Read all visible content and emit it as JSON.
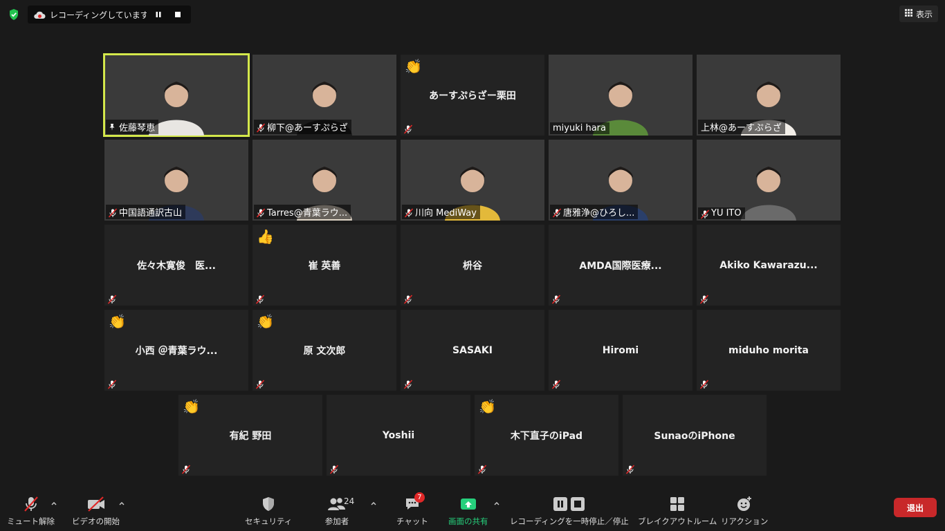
{
  "top": {
    "recording_text": "レコーディングしています...",
    "view_label": "表示"
  },
  "tiles": [
    {
      "name": "佐藤琴恵",
      "video": true,
      "bg": "bg-warm",
      "pinned": true,
      "active": true
    },
    {
      "name": "柳下@あーすぷらざ",
      "video": true,
      "bg": "bg-office",
      "muted": true
    },
    {
      "name": "あーすぷらざー栗田",
      "video": false,
      "emoji": "👏",
      "muted": true
    },
    {
      "name": "miyuki hara",
      "video": true,
      "bg": "bg-mountain",
      "muted": false
    },
    {
      "name": "上林@あーすぷらざ",
      "video": true,
      "bg": "bg-room",
      "muted": false
    },
    {
      "name": "中国語通訳古山",
      "video": true,
      "bg": "bg-white",
      "muted": true
    },
    {
      "name": "Tarres@青葉ラウ...",
      "video": true,
      "bg": "bg-red",
      "muted": true
    },
    {
      "name": "川向 MediWay",
      "video": true,
      "bg": "bg-light",
      "muted": true
    },
    {
      "name": "唐雅浄@ひろし...",
      "video": true,
      "bg": "bg-plain",
      "muted": true
    },
    {
      "name": "YU ITO",
      "video": true,
      "bg": "bg-curtain",
      "muted": true
    },
    {
      "name": "佐々木寛俊　医...",
      "video": false,
      "muted": true
    },
    {
      "name": "崔 英善",
      "video": false,
      "emoji": "👍",
      "muted": true
    },
    {
      "name": "枡谷",
      "video": false,
      "muted": true
    },
    {
      "name": "AMDA国際医療...",
      "video": false,
      "muted": true
    },
    {
      "name": "Akiko  Kawarazu...",
      "video": false,
      "muted": true
    },
    {
      "name": "小西 ＠青葉ラウ...",
      "video": false,
      "emoji": "👏",
      "muted": true
    },
    {
      "name": "原 文次郎",
      "video": false,
      "emoji": "👏",
      "muted": true
    },
    {
      "name": "SASAKI",
      "video": false,
      "muted": true
    },
    {
      "name": "Hiromi",
      "video": false,
      "muted": true
    },
    {
      "name": "miduho morita",
      "video": false,
      "muted": true
    },
    {
      "name": "有紀 野田",
      "video": false,
      "emoji": "👏",
      "muted": true
    },
    {
      "name": "Yoshii",
      "video": false,
      "muted": true
    },
    {
      "name": "木下直子のiPad",
      "video": false,
      "emoji": "👏",
      "muted": true
    },
    {
      "name": "SunaoのiPhone",
      "video": false,
      "muted": true
    }
  ],
  "toolbar": {
    "unmute": "ミュート解除",
    "start_video": "ビデオの開始",
    "security": "セキュリティ",
    "participants": "参加者",
    "participants_count": "24",
    "chat": "チャット",
    "chat_badge": "7",
    "share": "画面の共有",
    "recording": "レコーディングを一時停止／停止",
    "breakout": "ブレイクアウトルーム",
    "reactions": "リアクション",
    "leave": "退出"
  },
  "colors": {
    "active_speaker": "#d4e84b",
    "share_green": "#26d07c",
    "leave_red": "#c8282a",
    "mute_red": "#e02828"
  }
}
